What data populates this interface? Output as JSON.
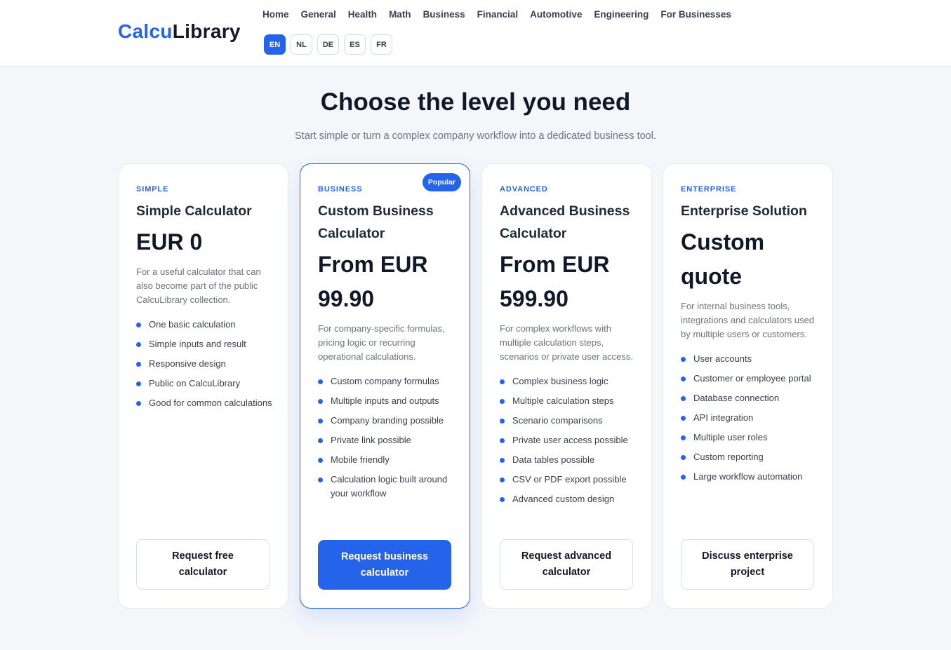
{
  "logo": {
    "part1": "Calcu",
    "part2": "Library"
  },
  "nav": [
    "Home",
    "General",
    "Health",
    "Math",
    "Business",
    "Financial",
    "Automotive",
    "Engineering",
    "For Businesses"
  ],
  "languages": [
    {
      "code": "EN",
      "active": true
    },
    {
      "code": "NL",
      "active": false
    },
    {
      "code": "DE",
      "active": false
    },
    {
      "code": "ES",
      "active": false
    },
    {
      "code": "FR",
      "active": false
    }
  ],
  "heading": {
    "title": "Choose the level you need",
    "subtitle": "Start simple or turn a complex company workflow into a dedicated business tool."
  },
  "plans": [
    {
      "tier": "SIMPLE",
      "name": "Simple Calculator",
      "price": "EUR 0",
      "description": "For a useful calculator that can also become part of the public CalcuLibrary collection.",
      "features": [
        "One basic calculation",
        "Simple inputs and result",
        "Responsive design",
        "Public on CalcuLibrary",
        "Good for common calculations"
      ],
      "cta": "Request free calculator"
    },
    {
      "tier": "BUSINESS",
      "badge": "Popular",
      "name": "Custom Business Calculator",
      "price": "From EUR 99.90",
      "description": "For company-specific formulas, pricing logic or recurring operational calculations.",
      "features": [
        "Custom company formulas",
        "Multiple inputs and outputs",
        "Company branding possible",
        "Private link possible",
        "Mobile friendly",
        "Calculation logic built around your workflow"
      ],
      "cta": "Request business calculator"
    },
    {
      "tier": "ADVANCED",
      "name": "Advanced Business Calculator",
      "price": "From EUR 599.90",
      "description": "For complex workflows with multiple calculation steps, scenarios or private user access.",
      "features": [
        "Complex business logic",
        "Multiple calculation steps",
        "Scenario comparisons",
        "Private user access possible",
        "Data tables possible",
        "CSV or PDF export possible",
        "Advanced custom design"
      ],
      "cta": "Request advanced calculator"
    },
    {
      "tier": "ENTERPRISE",
      "name": "Enterprise Solution",
      "price": "Custom quote",
      "description": "For internal business tools, integrations and calculators used by multiple users or customers.",
      "features": [
        "User accounts",
        "Customer or employee portal",
        "Database connection",
        "API integration",
        "Multiple user roles",
        "Custom reporting",
        "Large workflow automation"
      ],
      "cta": "Discuss enterprise project"
    }
  ],
  "colors": {
    "accent": "#2563eb",
    "background": "#f4f6fa",
    "text": "#111827"
  }
}
